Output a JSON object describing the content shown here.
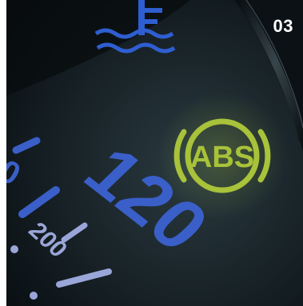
{
  "page_number": "03",
  "warning_light": {
    "label": "ABS",
    "color": "#a8c23a"
  },
  "speedometer": {
    "major_label": "120",
    "minor_label": "200",
    "color": "#3a5fc8",
    "minor_color": "#9aa6d8"
  },
  "temperature_gauge": {
    "label": "F",
    "icon": "coolant-temperature-icon",
    "color": "#2f5ed0"
  },
  "colors": {
    "background": "#0e1519",
    "highlight": "#2c3c42"
  }
}
